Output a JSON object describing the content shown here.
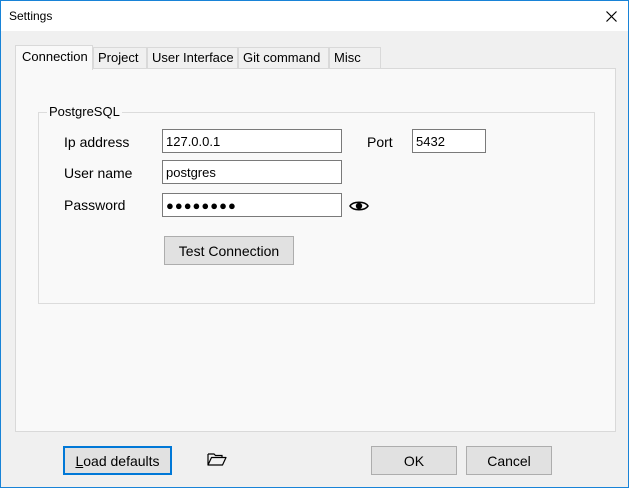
{
  "window": {
    "title": "Settings"
  },
  "tabs": [
    {
      "label": "Connection",
      "active": true
    },
    {
      "label": "Project",
      "active": false
    },
    {
      "label": "User Interface",
      "active": false
    },
    {
      "label": "Git command",
      "active": false
    },
    {
      "label": "Misc",
      "active": false
    }
  ],
  "postgres": {
    "group_title": "PostgreSQL",
    "ip_label": "Ip address",
    "ip_value": "127.0.0.1",
    "port_label": "Port",
    "port_value": "5432",
    "user_label": "User name",
    "user_value": "postgres",
    "password_label": "Password",
    "password_value": "●●●●●●●●",
    "test_button": "Test Connection"
  },
  "footer": {
    "load_defaults_first": "L",
    "load_defaults_rest": "oad defaults",
    "ok": "OK",
    "cancel": "Cancel"
  },
  "icons": {
    "close": "close-icon",
    "eye": "eye-icon",
    "folder": "folder-open-icon"
  },
  "colors": {
    "accent": "#0078d7",
    "window_border": "#1883d7",
    "panel_bg": "#f9f9f9",
    "dialog_bg": "#f0f0f0",
    "button_bg": "#e1e1e1"
  }
}
